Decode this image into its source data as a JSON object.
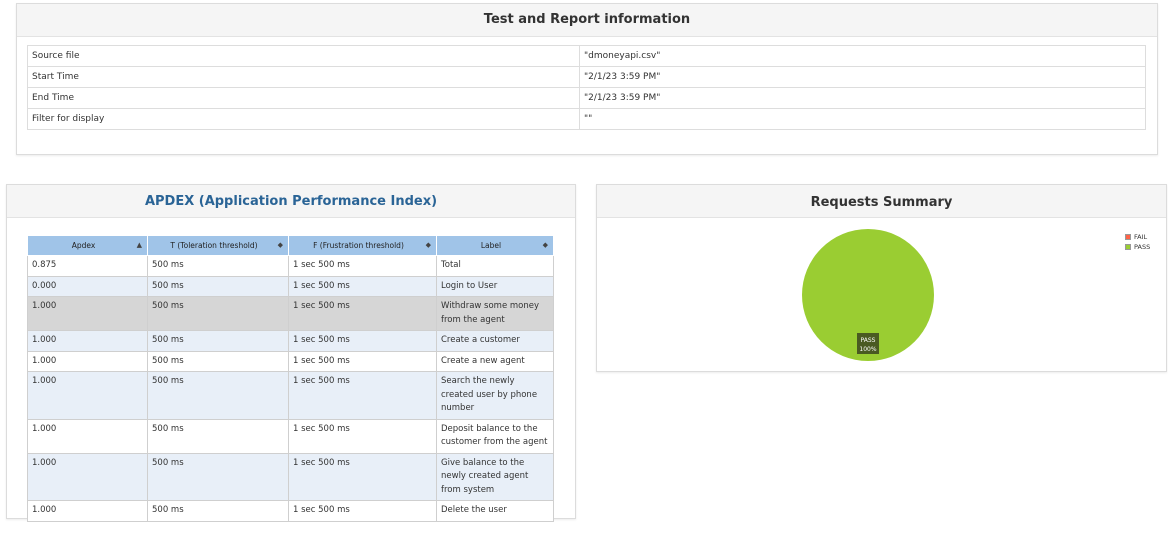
{
  "info": {
    "title": "Test and Report information",
    "rows": [
      {
        "key": "Source file",
        "value": "\"dmoneyapi.csv\""
      },
      {
        "key": "Start Time",
        "value": "\"2/1/23 3:59 PM\""
      },
      {
        "key": "End Time",
        "value": "\"2/1/23 3:59 PM\""
      },
      {
        "key": "Filter for display",
        "value": "\"\""
      }
    ]
  },
  "apdex": {
    "title": "APDEX (Application Performance Index)",
    "headers": [
      "Apdex",
      "T (Toleration threshold)",
      "F (Frustration threshold)",
      "Label"
    ],
    "sort_icons": [
      "▲",
      "◆",
      "◆",
      "◆"
    ],
    "rows": [
      {
        "apdex": "0.875",
        "t": "500 ms",
        "f": "1 sec 500 ms",
        "label": "Total"
      },
      {
        "apdex": "0.000",
        "t": "500 ms",
        "f": "1 sec 500 ms",
        "label": "Login to User"
      },
      {
        "apdex": "1.000",
        "t": "500 ms",
        "f": "1 sec 500 ms",
        "label": "Withdraw some money from the agent"
      },
      {
        "apdex": "1.000",
        "t": "500 ms",
        "f": "1 sec 500 ms",
        "label": "Create a customer"
      },
      {
        "apdex": "1.000",
        "t": "500 ms",
        "f": "1 sec 500 ms",
        "label": "Create a new agent"
      },
      {
        "apdex": "1.000",
        "t": "500 ms",
        "f": "1 sec 500 ms",
        "label": "Search the newly created user by phone number"
      },
      {
        "apdex": "1.000",
        "t": "500 ms",
        "f": "1 sec 500 ms",
        "label": "Deposit balance to the customer from the agent"
      },
      {
        "apdex": "1.000",
        "t": "500 ms",
        "f": "1 sec 500 ms",
        "label": "Give balance to the newly created agent from system"
      },
      {
        "apdex": "1.000",
        "t": "500 ms",
        "f": "1 sec 500 ms",
        "label": "Delete the user"
      }
    ]
  },
  "requests": {
    "title": "Requests Summary",
    "legend": [
      {
        "name": "FAIL",
        "color": "#ff6347"
      },
      {
        "name": "PASS",
        "color": "#9acd32"
      }
    ],
    "slice_label": "PASS",
    "slice_value": "100%"
  },
  "chart_data": {
    "type": "pie",
    "title": "Requests Summary",
    "categories": [
      "FAIL",
      "PASS"
    ],
    "values": [
      0,
      100
    ],
    "colors": [
      "#ff6347",
      "#9acd32"
    ],
    "legend": "top-right"
  }
}
